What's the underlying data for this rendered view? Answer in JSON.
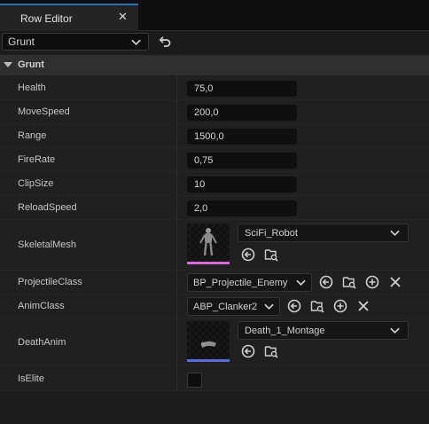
{
  "tab": {
    "title": "Row Editor",
    "close_icon": "close-icon"
  },
  "toolbar": {
    "row_selector_value": "Grunt",
    "back_icon": "undo-arrow-icon"
  },
  "category": {
    "label": "Grunt"
  },
  "properties": {
    "health": {
      "label": "Health",
      "value": "75,0"
    },
    "move_speed": {
      "label": "MoveSpeed",
      "value": "200,0"
    },
    "range": {
      "label": "Range",
      "value": "1500,0"
    },
    "fire_rate": {
      "label": "FireRate",
      "value": "0,75"
    },
    "clip_size": {
      "label": "ClipSize",
      "value": "10"
    },
    "reload_speed": {
      "label": "ReloadSpeed",
      "value": "2,0"
    },
    "skeletal_mesh": {
      "label": "SkeletalMesh",
      "value": "SciFi_Robot",
      "accent": "#d86ad8"
    },
    "projectile_class": {
      "label": "ProjectileClass",
      "value": "BP_Projectile_Enemy"
    },
    "anim_class": {
      "label": "AnimClass",
      "value": "ABP_Clanker2"
    },
    "death_anim": {
      "label": "DeathAnim",
      "value": "Death_1_Montage",
      "accent": "#5b6cd8"
    },
    "is_elite": {
      "label": "IsElite",
      "checked": false
    }
  },
  "colors": {
    "tab_accent": "#2f6fb6",
    "background": "#1a1a1a"
  }
}
